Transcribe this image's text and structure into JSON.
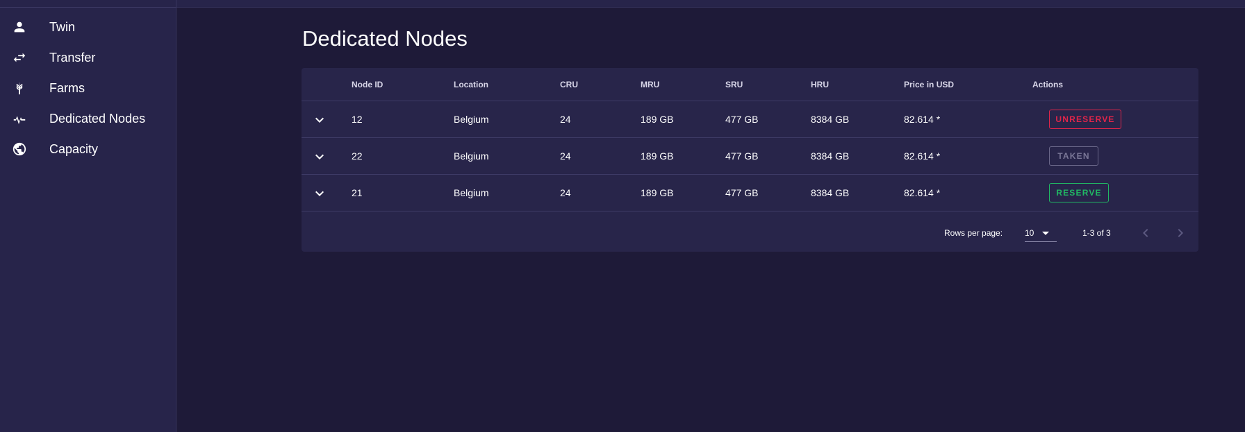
{
  "sidebar": {
    "items": [
      {
        "label": "Twin",
        "icon": "person-icon"
      },
      {
        "label": "Transfer",
        "icon": "swap-arrows-icon"
      },
      {
        "label": "Farms",
        "icon": "wheat-icon"
      },
      {
        "label": "Dedicated Nodes",
        "icon": "pulse-icon"
      },
      {
        "label": "Capacity",
        "icon": "globe-icon"
      }
    ]
  },
  "main": {
    "title": "Dedicated Nodes",
    "table": {
      "headers": [
        "Node ID",
        "Location",
        "CRU",
        "MRU",
        "SRU",
        "HRU",
        "Price in USD",
        "Actions"
      ],
      "rows": [
        {
          "node_id": "12",
          "location": "Belgium",
          "cru": "24",
          "mru": "189 GB",
          "sru": "477 GB",
          "hru": "8384 GB",
          "price": "82.614 *",
          "action": "UNRESERVE",
          "action_color": "#e0254a"
        },
        {
          "node_id": "22",
          "location": "Belgium",
          "cru": "24",
          "mru": "189 GB",
          "sru": "477 GB",
          "hru": "8384 GB",
          "price": "82.614 *",
          "action": "TAKEN",
          "action_color": "#7a7797"
        },
        {
          "node_id": "21",
          "location": "Belgium",
          "cru": "24",
          "mru": "189 GB",
          "sru": "477 GB",
          "hru": "8384 GB",
          "price": "82.614 *",
          "action": "RESERVE",
          "action_color": "#21b864"
        }
      ]
    },
    "footer": {
      "rows_per_page_label": "Rows per page:",
      "rows_per_page_value": "10",
      "range": "1-3 of 3"
    }
  },
  "colors": {
    "background": "#1e1a38",
    "surface": "#28254a",
    "danger": "#e0254a",
    "success": "#21b864",
    "disabled": "#7a7797"
  }
}
